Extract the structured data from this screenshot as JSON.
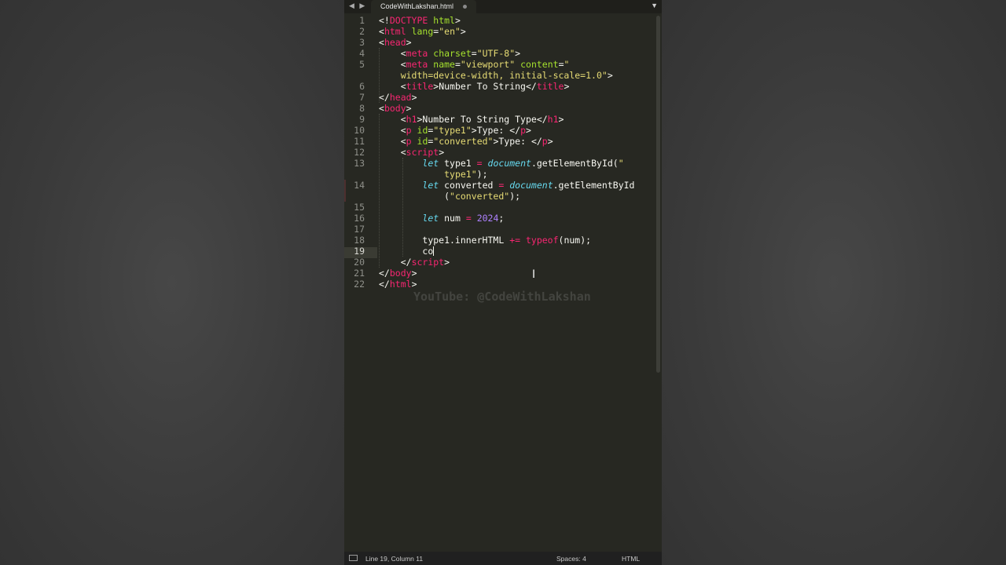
{
  "tab": {
    "filename": "CodeWithLakshan.html"
  },
  "editor": {
    "lines": [
      {
        "n": "1",
        "html": "<span class='c-plain'>&lt;!</span><span class='c-tag'>DOCTYPE</span> <span class='c-attr'>html</span><span class='c-plain'>&gt;</span>"
      },
      {
        "n": "2",
        "html": "<span class='c-plain'>&lt;</span><span class='c-tag'>html</span> <span class='c-attr'>lang</span><span class='c-plain'>=</span><span class='c-str'>\"en\"</span><span class='c-plain'>&gt;</span>"
      },
      {
        "n": "3",
        "html": "<span class='c-plain'>&lt;</span><span class='c-tag'>head</span><span class='c-plain'>&gt;</span>"
      },
      {
        "n": "4",
        "html": "    <span class='c-plain'>&lt;</span><span class='c-tag'>meta</span> <span class='c-attr'>charset</span><span class='c-plain'>=</span><span class='c-str'>\"UTF-8\"</span><span class='c-plain'>&gt;</span>"
      },
      {
        "n": "5",
        "html": "    <span class='c-plain'>&lt;</span><span class='c-tag'>meta</span> <span class='c-attr'>name</span><span class='c-plain'>=</span><span class='c-str'>\"viewport\"</span> <span class='c-attr'>content</span><span class='c-plain'>=</span><span class='c-str'>\"</span>"
      },
      {
        "n": "",
        "html": "    <span class='c-str'>width=device-width, initial-scale=1.0\"</span><span class='c-plain'>&gt;</span>"
      },
      {
        "n": "6",
        "html": "    <span class='c-plain'>&lt;</span><span class='c-tag'>title</span><span class='c-plain'>&gt;Number To String&lt;/</span><span class='c-tag'>title</span><span class='c-plain'>&gt;</span>"
      },
      {
        "n": "7",
        "html": "<span class='c-plain'>&lt;/</span><span class='c-tag'>head</span><span class='c-plain'>&gt;</span>"
      },
      {
        "n": "8",
        "html": "<span class='c-plain'>&lt;</span><span class='c-tag'>body</span><span class='c-plain'>&gt;</span>"
      },
      {
        "n": "9",
        "html": "    <span class='c-plain'>&lt;</span><span class='c-tag'>h1</span><span class='c-plain'>&gt;Number To String Type&lt;/</span><span class='c-tag'>h1</span><span class='c-plain'>&gt;</span>"
      },
      {
        "n": "10",
        "html": "    <span class='c-plain'>&lt;</span><span class='c-tag'>p</span> <span class='c-attr'>id</span><span class='c-plain'>=</span><span class='c-str'>\"type1\"</span><span class='c-plain'>&gt;Type: &lt;/</span><span class='c-tag'>p</span><span class='c-plain'>&gt;</span>"
      },
      {
        "n": "11",
        "html": "    <span class='c-plain'>&lt;</span><span class='c-tag'>p</span> <span class='c-attr'>id</span><span class='c-plain'>=</span><span class='c-str'>\"converted\"</span><span class='c-plain'>&gt;Type: &lt;/</span><span class='c-tag'>p</span><span class='c-plain'>&gt;</span>"
      },
      {
        "n": "12",
        "html": "    <span class='c-plain'>&lt;</span><span class='c-tag'>script</span><span class='c-plain'>&gt;</span>"
      },
      {
        "n": "13",
        "html": "        <span class='c-kw'>let</span> <span class='c-plain'>type1</span> <span class='c-op'>=</span> <span class='c-var'>document</span><span class='c-plain'>.getElementById(</span><span class='c-str'>\"</span>"
      },
      {
        "n": "",
        "html": "            <span class='c-str'>type1\"</span><span class='c-plain'>);</span>"
      },
      {
        "n": "14",
        "html": "        <span class='c-kw'>let</span> <span class='c-plain'>converted</span> <span class='c-op'>=</span> <span class='c-var'>document</span><span class='c-plain'>.getElementById</span>"
      },
      {
        "n": "",
        "html": "            <span class='c-plain'>(</span><span class='c-str'>\"converted\"</span><span class='c-plain'>);</span>"
      },
      {
        "n": "15",
        "html": ""
      },
      {
        "n": "16",
        "html": "        <span class='c-kw'>let</span> <span class='c-plain'>num</span> <span class='c-op'>=</span> <span class='c-num'>2024</span><span class='c-plain'>;</span>"
      },
      {
        "n": "17",
        "html": ""
      },
      {
        "n": "18",
        "html": "        <span class='c-plain'>type1.innerHTML</span> <span class='c-op'>+=</span> <span class='c-op'>typeof</span><span class='c-plain'>(num);</span>"
      },
      {
        "n": "19",
        "html": "        <span class='c-plain'>co</span><span class='caret'></span>"
      },
      {
        "n": "20",
        "html": "    <span class='c-plain'>&lt;/</span><span class='c-tag'>script</span><span class='c-plain'>&gt;</span>"
      },
      {
        "n": "21",
        "html": "<span class='c-plain'>&lt;/</span><span class='c-tag'>body</span><span class='c-plain'>&gt;</span>"
      },
      {
        "n": "22",
        "html": "<span class='c-plain'>&lt;/</span><span class='c-tag'>html</span><span class='c-plain'>&gt;</span>"
      }
    ]
  },
  "watermark": "YouTube: @CodeWithLakshan",
  "status": {
    "position": "Line 19, Column 11",
    "spaces": "Spaces: 4",
    "syntax": "HTML"
  },
  "icons": {
    "nav": "back-forward-arrows",
    "menu": "tab-dropdown-triangle",
    "cursor": "i-beam-cursor"
  }
}
